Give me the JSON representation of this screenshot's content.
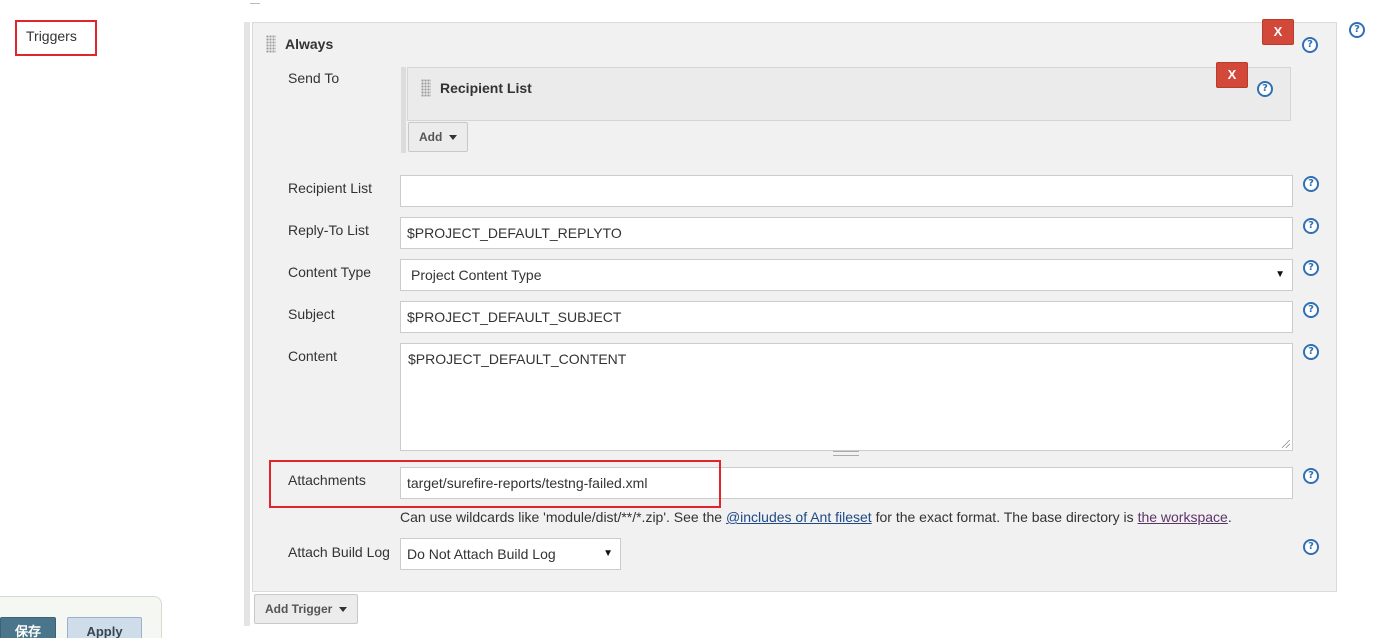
{
  "left_panel": {
    "triggers_label": "Triggers"
  },
  "trigger": {
    "title": "Always",
    "remove_label": "X",
    "send_to_label": "Send To",
    "recipient_block": {
      "title": "Recipient List",
      "remove_label": "X",
      "add_label": "Add"
    },
    "fields": {
      "recipient_list": {
        "label": "Recipient List",
        "value": ""
      },
      "reply_to": {
        "label": "Reply-To List",
        "value": "$PROJECT_DEFAULT_REPLYTO"
      },
      "content_type": {
        "label": "Content Type",
        "value": "Project Content Type"
      },
      "subject": {
        "label": "Subject",
        "value": "$PROJECT_DEFAULT_SUBJECT"
      },
      "content": {
        "label": "Content",
        "value": "$PROJECT_DEFAULT_CONTENT"
      },
      "attachments": {
        "label": "Attachments",
        "value": "target/surefire-reports/testng-failed.xml"
      },
      "attach_build_log": {
        "label": "Attach Build Log",
        "value": "Do Not Attach Build Log"
      }
    },
    "attachments_hint": {
      "part1": "Can use wildcards like 'module/dist/**/*.zip'. See the ",
      "link1": "@includes of Ant fileset",
      "part2": " for the exact format. The base directory is ",
      "link2": "the workspace",
      "part3": "."
    }
  },
  "add_trigger_label": "Add Trigger",
  "footer": {
    "save_label": "保存",
    "apply_label": "Apply"
  },
  "icons": {
    "help": "help-icon",
    "drag": "drag-handle-icon",
    "caret": "caret-down-icon"
  },
  "colors": {
    "remove_red": "#d24939",
    "help_blue": "#2f6fb3",
    "highlight_red": "#e0262b",
    "save_blue": "#4b758b",
    "link_blue": "#204a87"
  }
}
